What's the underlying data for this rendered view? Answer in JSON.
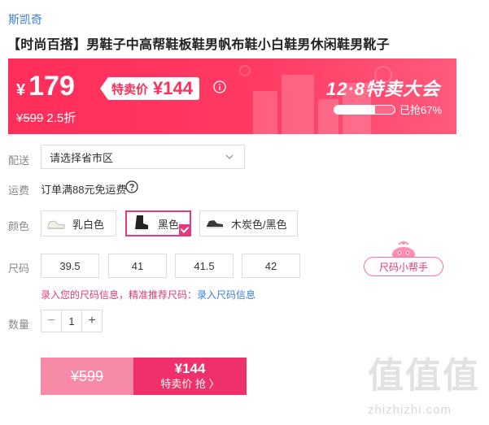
{
  "brand": "斯凯奇",
  "title": "【时尚百搭】男鞋子中高帮鞋板鞋男帆布鞋小白鞋男休闲鞋男靴子",
  "promo": {
    "current_price": "179",
    "currency": "¥",
    "tag_label": "特卖价",
    "tag_price": "¥144",
    "original_price": "¥599",
    "discount": "2.5折",
    "event_title": "12·8特卖大会",
    "grabbed_percent": 67,
    "grabbed_text": "已抢67%",
    "info_icon": "info-icon",
    "colors": {
      "banner": "#ff2d5a",
      "accent": "#e23a7a",
      "link": "#3a7fd5"
    }
  },
  "delivery": {
    "label": "配送",
    "placeholder": "请选择省市区"
  },
  "shipping": {
    "label": "运费",
    "text": "订单满88元免运费"
  },
  "color": {
    "label": "颜色",
    "options": [
      {
        "name": "乳白色",
        "selected": false
      },
      {
        "name": "黑色",
        "selected": true
      },
      {
        "name": "木炭色/黑色",
        "selected": false
      }
    ]
  },
  "size": {
    "label": "尺码",
    "options": [
      "39.5",
      "41",
      "41.5",
      "42"
    ],
    "helper": "尺码小帮手",
    "info_prompt": "录入您的尺码信息，精准推荐尺码：",
    "info_link": "录入尺码信息"
  },
  "quantity": {
    "label": "数量",
    "value": "1",
    "minus": "−",
    "plus": "+"
  },
  "buy": {
    "original": "¥599",
    "price": "¥144",
    "cta": "特卖价 抢 〉"
  },
  "watermark": {
    "big": "值值值",
    "small": "zhizhizhi.com"
  }
}
